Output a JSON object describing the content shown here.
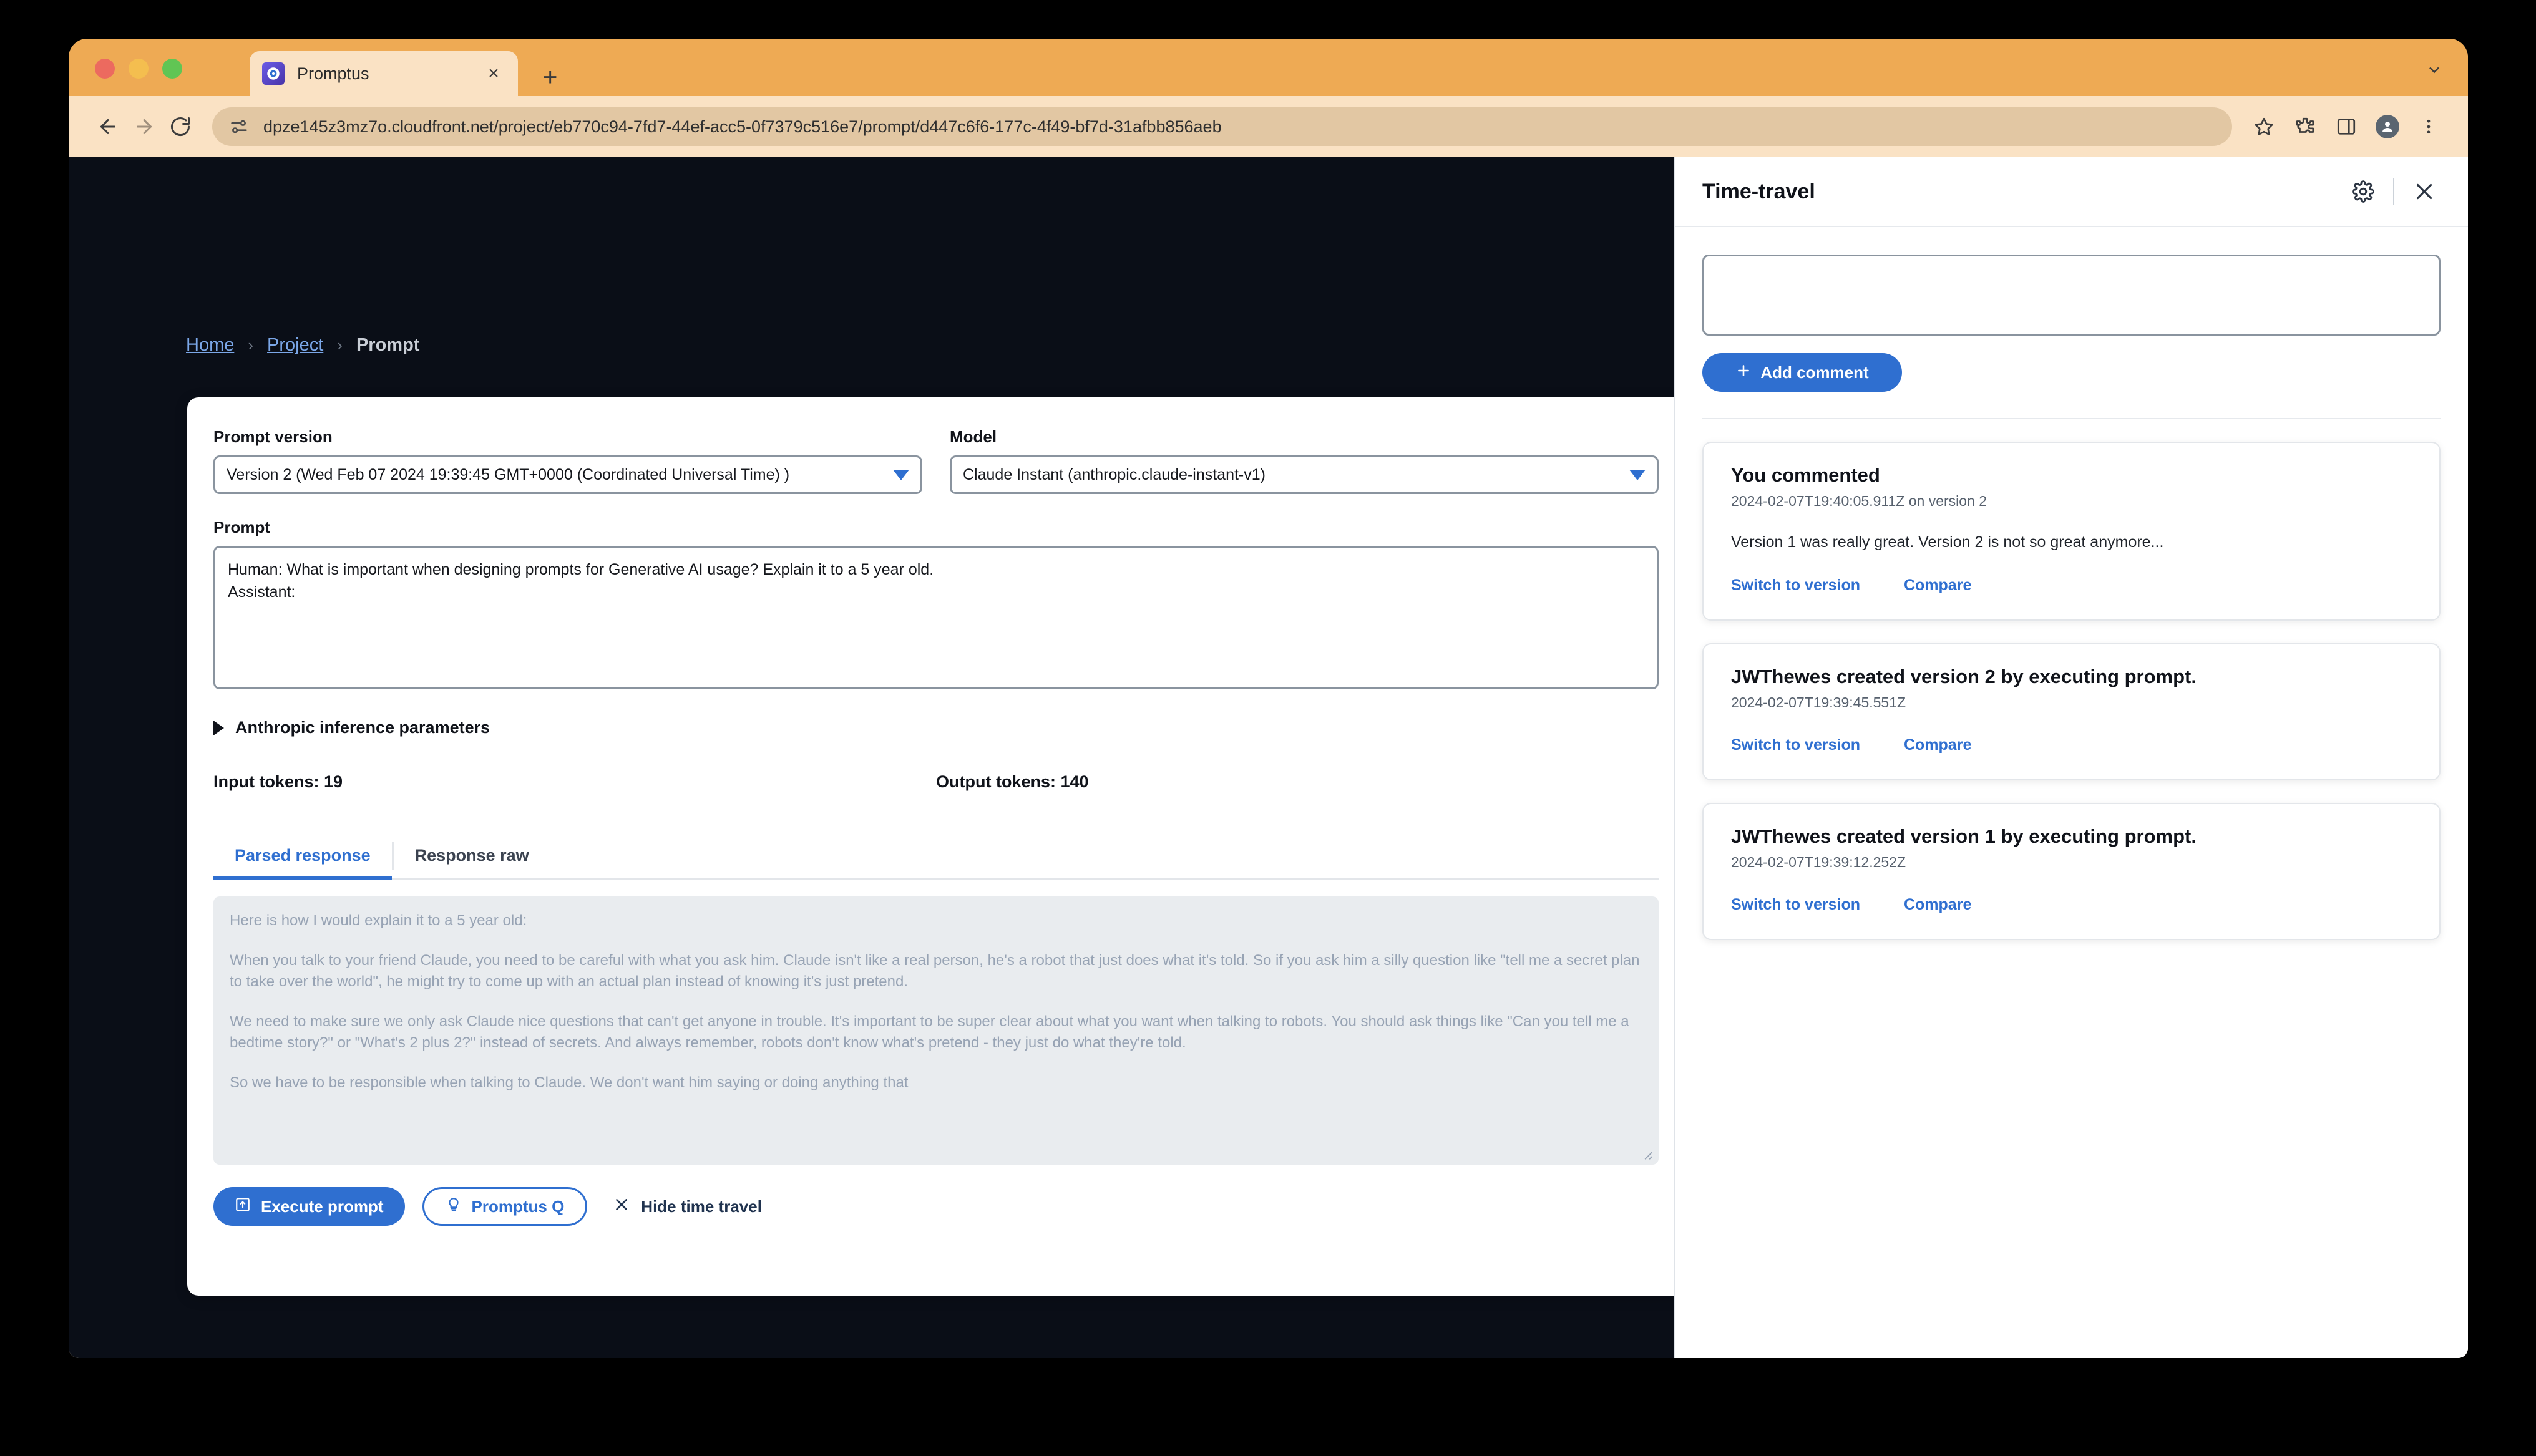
{
  "browser": {
    "tab": {
      "title": "Promptus",
      "favicon_name": "promptus-favicon",
      "close_label": "×"
    },
    "new_tab_label": "+",
    "url": "dpze145z3mz7o.cloudfront.net/project/eb770c94-7fd7-44ef-acc5-0f7379c516e7/prompt/d447c6f6-177c-4f49-bf7d-31afbb856aeb",
    "url_host": "dpze145z3mz7o.cloudfront.net",
    "url_path": "/project/eb770c94-7fd7-44ef-acc5-0f7379c516e7/prompt/d447c6f6-177c-4f49-bf7d-31afbb856aeb"
  },
  "breadcrumb": {
    "items": [
      {
        "label": "Home",
        "current": false
      },
      {
        "label": "Project",
        "current": false
      },
      {
        "label": "Prompt",
        "current": true
      }
    ],
    "separator": "›"
  },
  "form": {
    "version_label": "Prompt version",
    "version_value": "Version 2 (Wed Feb 07 2024 19:39:45 GMT+0000 (Coordinated Universal Time) )",
    "model_label": "Model",
    "model_value": "Claude Instant (anthropic.claude-instant-v1)",
    "prompt_label": "Prompt",
    "prompt_value": "Human: What is important when designing prompts for Generative AI usage? Explain it to a 5 year old.\nAssistant:",
    "accordion_label": "Anthropic inference parameters",
    "input_tokens": "Input tokens: 19",
    "output_tokens": "Output tokens: 140"
  },
  "response_tabs": [
    {
      "label": "Parsed response",
      "active": true
    },
    {
      "label": "Response raw",
      "active": false
    }
  ],
  "response": {
    "paragraphs": [
      "Here is how I would explain it to a 5 year old:",
      "When you talk to your friend Claude, you need to be careful with what you ask him. Claude isn't like a real person, he's a robot that just does what it's told. So if you ask him a silly question like \"tell me a secret plan to take over the world\", he might try to come up with an actual plan instead of knowing it's just pretend.",
      "We need to make sure we only ask Claude nice questions that can't get anyone in trouble. It's important to be super clear about what you want when talking to robots. You should ask things like \"Can you tell me a bedtime story?\" or \"What's 2 plus 2?\" instead of secrets. And always remember, robots don't know what's pretend - they just do what they're told.",
      "So we have to be responsible when talking to Claude. We don't want him saying or doing anything that"
    ]
  },
  "actions": {
    "execute_label": "Execute prompt",
    "promptus_q_label": "Promptus Q",
    "hide_time_travel_label": "Hide time travel"
  },
  "time_travel": {
    "title": "Time-travel",
    "comment_placeholder": "",
    "comment_value": "",
    "add_comment_label": "Add comment",
    "events": [
      {
        "title": "You commented",
        "time": "2024-02-07T19:40:05.911Z on version 2",
        "text": "Version 1 was really great. Version 2 is not so great anymore...",
        "switch_label": "Switch to version",
        "compare_label": "Compare"
      },
      {
        "title": "JWThewes created version 2 by executing prompt.",
        "time": "2024-02-07T19:39:45.551Z",
        "text": "",
        "switch_label": "Switch to version",
        "compare_label": "Compare"
      },
      {
        "title": "JWThewes created version 1 by executing prompt.",
        "time": "2024-02-07T19:39:12.252Z",
        "text": "",
        "switch_label": "Switch to version",
        "compare_label": "Compare"
      }
    ]
  },
  "colors": {
    "accent": "#2f6fd0",
    "browser_chrome": "#eeaa54",
    "toolbar": "#fae2c4",
    "page_dark": "#0a0e17",
    "link": "#7ba7e8"
  }
}
